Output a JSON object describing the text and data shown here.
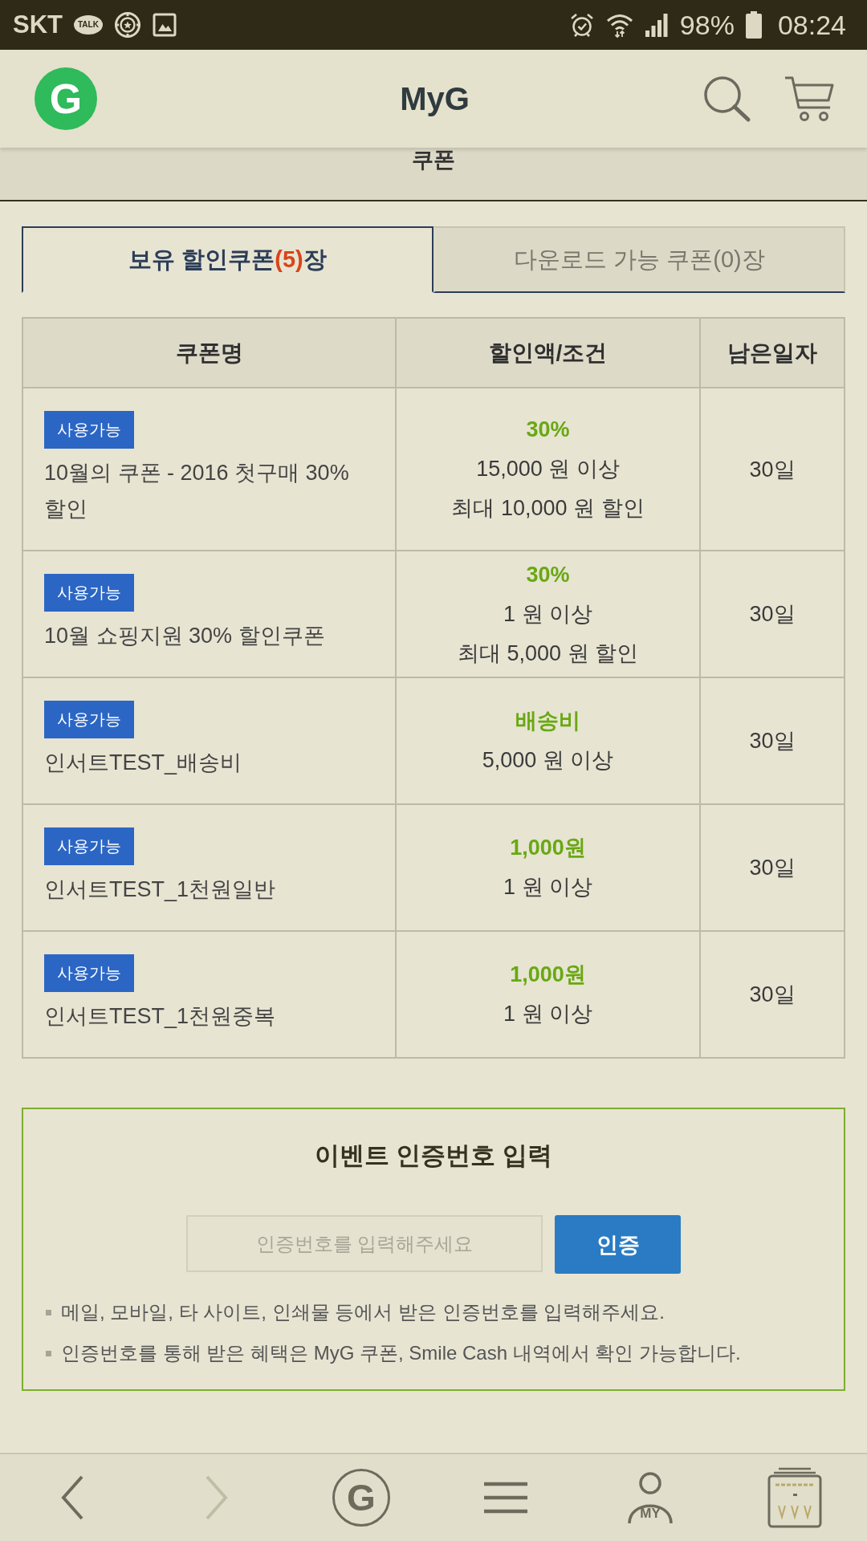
{
  "status_bar": {
    "carrier": "SKT",
    "chat_badge": "TALK",
    "battery": "98%",
    "time": "08:24"
  },
  "header": {
    "logo": "G",
    "title": "MyG"
  },
  "sub_header": {
    "title": "쿠폰"
  },
  "tabs": [
    {
      "label": "보유 할인쿠폰",
      "count": "(5)",
      "suffix": "장",
      "selected": true
    },
    {
      "label": "다운로드 가능 쿠폰",
      "count": "(0)",
      "suffix": "장",
      "selected": false
    }
  ],
  "table": {
    "columns": [
      "쿠폰명",
      "할인액/조건",
      "남은일자"
    ],
    "rows": [
      {
        "badge": "사용가능",
        "name": "10월의 쿠폰 - 2016 첫구매 30% 할인",
        "discount": "30%",
        "conditions": [
          "15,000 원 이상",
          "최대 10,000 원 할인"
        ],
        "days": "30일"
      },
      {
        "badge": "사용가능",
        "name": "10월 쇼핑지원 30% 할인쿠폰",
        "discount": "30%",
        "conditions": [
          "1 원 이상",
          "최대 5,000 원 할인"
        ],
        "days": "30일"
      },
      {
        "badge": "사용가능",
        "name": "인서트TEST_배송비",
        "discount": "배송비",
        "conditions": [
          "5,000 원 이상"
        ],
        "days": "30일"
      },
      {
        "badge": "사용가능",
        "name": "인서트TEST_1천원일반",
        "discount": "1,000원",
        "conditions": [
          "1 원 이상"
        ],
        "days": "30일"
      },
      {
        "badge": "사용가능",
        "name": "인서트TEST_1천원중복",
        "discount": "1,000원",
        "conditions": [
          "1 원 이상"
        ],
        "days": "30일"
      }
    ]
  },
  "event": {
    "title": "이벤트 인증번호 입력",
    "input": {
      "placeholder": "인증번호를 입력해주세요"
    },
    "button": "인증",
    "notes": [
      "메일, 모바일, 타 사이트, 인쇄물 등에서 받은 인증번호를 입력해주세요.",
      "인증번호를 통해 받은 혜택은 MyG 쿠폰, Smile Cash 내역에서 확인 가능합니다."
    ]
  },
  "bottom_nav": [
    {
      "kind": "back",
      "disabled": false
    },
    {
      "kind": "forward",
      "disabled": true
    },
    {
      "kind": "home",
      "label": "G",
      "disabled": false
    },
    {
      "kind": "menu",
      "disabled": false
    },
    {
      "kind": "my",
      "label": "MY",
      "disabled": false
    },
    {
      "kind": "tabs",
      "disabled": false
    }
  ]
}
